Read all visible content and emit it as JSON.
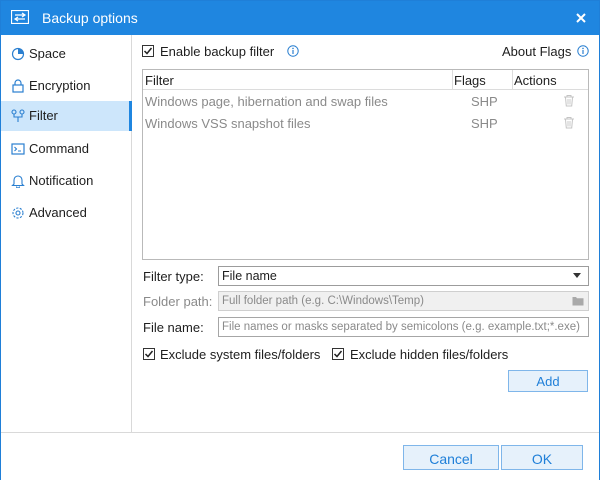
{
  "window": {
    "title": "Backup options"
  },
  "sidebar": {
    "items": [
      {
        "label": "Space",
        "icon": "pie-chart-icon"
      },
      {
        "label": "Encryption",
        "icon": "lock-icon"
      },
      {
        "label": "Filter",
        "icon": "filter-icon",
        "active": true
      },
      {
        "label": "Command",
        "icon": "terminal-icon"
      },
      {
        "label": "Notification",
        "icon": "bell-icon"
      },
      {
        "label": "Advanced",
        "icon": "gear-icon"
      }
    ]
  },
  "filter_panel": {
    "enable_label": "Enable backup filter",
    "enable_checked": true,
    "about_flags": "About Flags",
    "table": {
      "columns": [
        "Filter",
        "Flags",
        "Actions"
      ],
      "rows": [
        {
          "filter": "Windows page, hibernation and swap files",
          "flags": "SHP"
        },
        {
          "filter": "Windows VSS snapshot files",
          "flags": "SHP"
        }
      ]
    },
    "filter_type_label": "Filter type:",
    "filter_type_value": "File name",
    "folder_path_label": "Folder path:",
    "folder_path_placeholder": "Full folder path (e.g. C:\\Windows\\Temp)",
    "file_name_label": "File name:",
    "file_name_placeholder": "File names or masks separated by semicolons (e.g. example.txt;*.exe)",
    "exclude_system_label": "Exclude system files/folders",
    "exclude_system_checked": true,
    "exclude_hidden_label": "Exclude hidden files/folders",
    "exclude_hidden_checked": true,
    "add_label": "Add"
  },
  "footer": {
    "cancel_label": "Cancel",
    "ok_label": "OK"
  },
  "colors": {
    "accent": "#1f86e0",
    "active_bg": "#cde6fb",
    "button_bg": "#e6f1fb",
    "button_text": "#1f7fd8"
  }
}
